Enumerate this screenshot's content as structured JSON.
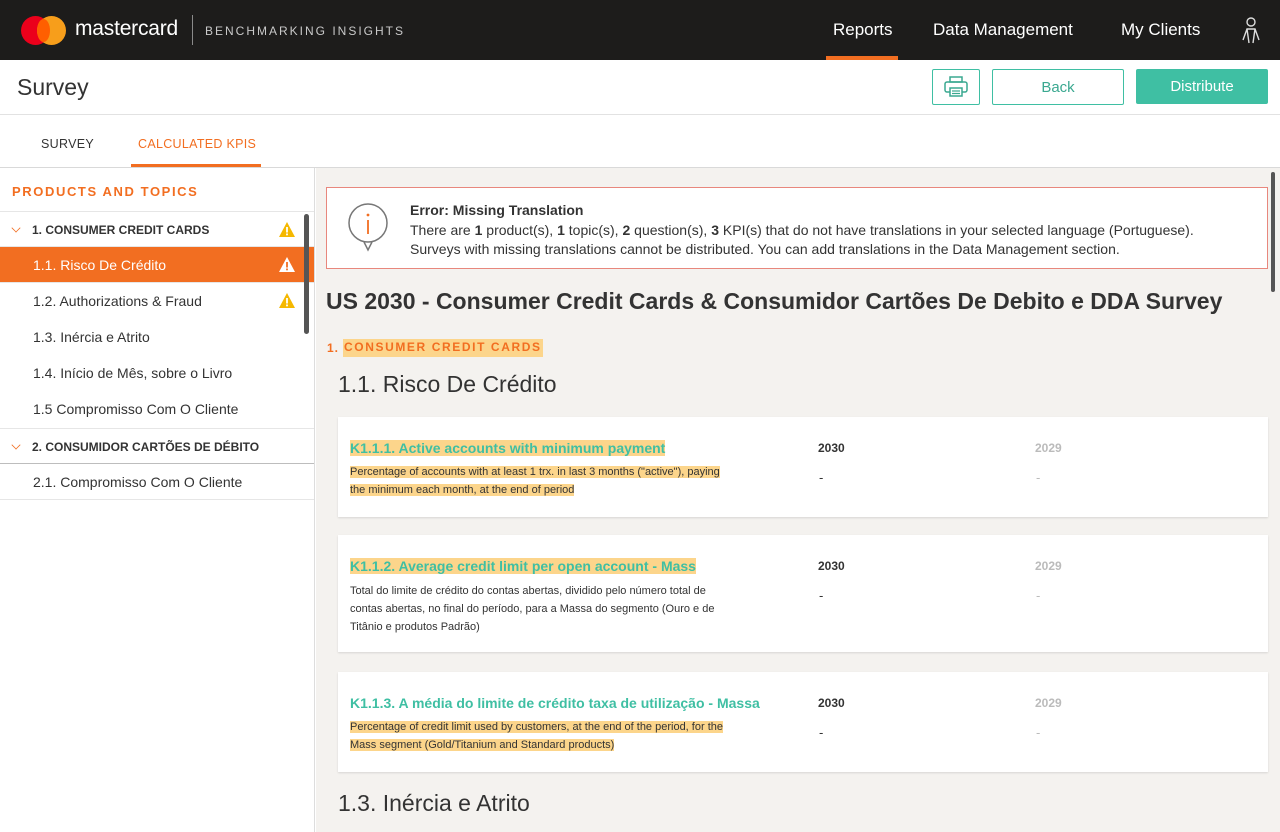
{
  "topnav": {
    "brand": "mastercard",
    "product": "BENCHMARKING INSIGHTS",
    "items": [
      {
        "label": "Reports"
      },
      {
        "label": "Data Management"
      },
      {
        "label": "My Clients"
      }
    ],
    "active_item": "Reports",
    "accent_color": "#f26e21"
  },
  "header": {
    "title": "Survey",
    "back_label": "Back",
    "distribute_label": "Distribute",
    "print_icon": "printer-icon"
  },
  "tabs": {
    "survey": "SURVEY",
    "kpis": "CALCULATED KPIS",
    "active": "CALCULATED KPIS"
  },
  "sidebar": {
    "heading": "PRODUCTS AND TOPICS",
    "groups": [
      {
        "label": "1. CONSUMER CREDIT CARDS",
        "warning": true
      },
      {
        "label": "2. CONSUMIDOR CARTÕES DE DÉBITO",
        "warning": false
      }
    ],
    "items": [
      {
        "label": "1.1. Risco De Crédito",
        "warning": true,
        "active": true
      },
      {
        "label": "1.2. Authorizations & Fraud",
        "warning": true
      },
      {
        "label": "1.3. Inércia e Atrito"
      },
      {
        "label": "1.4. Início de Mês, sobre o Livro"
      },
      {
        "label": "1.5 Compromisso Com O Cliente"
      },
      {
        "label": "2.1. Compromisso Com O Cliente"
      }
    ]
  },
  "error": {
    "title": "Error: Missing Translation",
    "line1_pre": "There are ",
    "products": "1",
    "line1_a": " product(s), ",
    "topics": "1",
    "line1_b": " topic(s), ",
    "questions": "2",
    "line1_c": " question(s), ",
    "kpis": "3",
    "line1_d": " KPI(s) that do not have translations in your selected language (Portuguese).",
    "line2": "Surveys with missing translations cannot be distributed. You can add translations in the Data Management section."
  },
  "main": {
    "survey_title": "US 2030 - Consumer Credit Cards & Consumidor Cartões De Debito e DDA Survey",
    "section_num": "1.",
    "section_name": "CONSUMER CREDIT CARDS",
    "topics": [
      {
        "title": "1.1. Risco De Crédito"
      },
      {
        "title": "1.3. Inércia e Atrito"
      }
    ],
    "year_current": "2030",
    "year_previous": "2029",
    "empty_value": "-",
    "kpis": [
      {
        "name": "K1.1.1. Active accounts with minimum payment",
        "desc_line1": "Percentage of accounts with at least 1 trx. in last 3 months (\"active\"), paying",
        "desc_line2": "the minimum each month, at the end of period"
      },
      {
        "name": "K1.1.2. Average credit limit per open account - Mass",
        "desc_line1": "Total do limite de crédito do contas abertas, dividido pelo número total de",
        "desc_line2": "contas abertas, no final do período, para a Massa do segmento (Ouro e de",
        "desc_line3": "Titânio e produtos Padrão)"
      },
      {
        "name": "K1.1.3. A média do limite de crédito taxa de utilização - Massa",
        "desc_line1": "Percentage of credit limit used by customers, at the end of the period, for the",
        "desc_line2": "Mass segment (Gold/Titanium and Standard products)"
      }
    ]
  }
}
